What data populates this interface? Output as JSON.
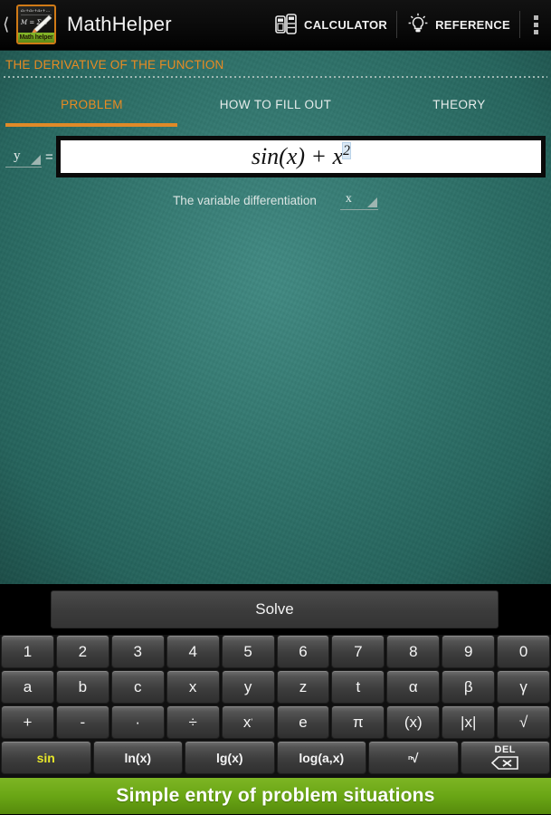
{
  "actionbar": {
    "back_icon": "back-chevron-icon",
    "app_icon": {
      "formula_top": "a₁+a₂+a₃+…",
      "formula_mid": "M = Σ p",
      "label": "Math helper"
    },
    "title": "MathHelper",
    "actions": [
      {
        "label": "CALCULATOR",
        "icon": "calculator-icon"
      },
      {
        "label": "REFERENCE",
        "icon": "lightbulb-icon"
      }
    ],
    "overflow_icon": "overflow-menu-icon"
  },
  "board": {
    "subtitle": "THE DERIVATIVE OF THE FUNCTION",
    "tabs": [
      {
        "label": "PROBLEM",
        "active": true
      },
      {
        "label": "HOW TO FILL OUT",
        "active": false
      },
      {
        "label": "THEORY",
        "active": false
      }
    ],
    "function_spinner_value": "y",
    "equals_sign": "=",
    "formula": {
      "base": "sin(x) + x",
      "exponent": "2",
      "full": "sin(x) + x^2"
    },
    "variable_label": "The variable differentiation",
    "variable_spinner_value": "x"
  },
  "solve": {
    "label": "Solve"
  },
  "keyboard": {
    "rows": [
      {
        "name": "digits",
        "keys": [
          "1",
          "2",
          "3",
          "4",
          "5",
          "6",
          "7",
          "8",
          "9",
          "0"
        ]
      },
      {
        "name": "letters",
        "keys": [
          "a",
          "b",
          "c",
          "x",
          "y",
          "z",
          "t",
          "α",
          "β",
          "γ"
        ]
      },
      {
        "name": "operators",
        "keys": [
          "+",
          "-",
          "·",
          "÷",
          "x",
          "e",
          "π",
          "(x)",
          "|x|",
          "√"
        ]
      },
      {
        "name": "functions",
        "keys": [
          "sin",
          "ln(x)",
          "lg(x)",
          "log(a,x)",
          "√",
          "DEL"
        ]
      }
    ],
    "power_key_sup": "'",
    "nth_root_sup": "n",
    "del_label": "DEL",
    "del_icon": "backspace-icon",
    "highlighted_key": "sin"
  },
  "banner": {
    "text": "Simple entry of problem situations"
  },
  "colors": {
    "accent_orange": "#e98b22",
    "board_teal": "#2f7970",
    "banner_green": "#6aa615",
    "key_highlight_yellow": "#e6e62a"
  }
}
